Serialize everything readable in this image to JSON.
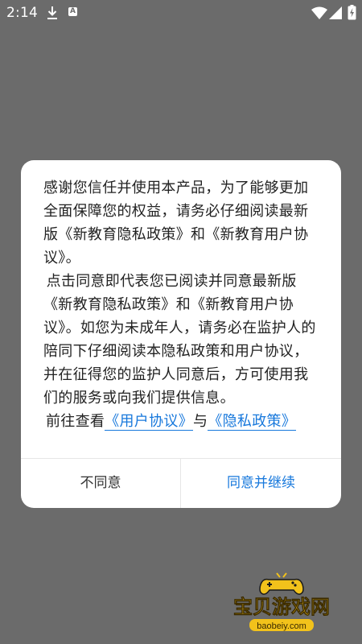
{
  "status_bar": {
    "time": "2:14",
    "notification_badge": "A",
    "icons": [
      "download-icon",
      "a-notification-icon",
      "wifi-icon",
      "signal-icon",
      "battery-icon"
    ]
  },
  "dialog": {
    "paragraph_1": "感谢您信任并使用本产品，为了能够更加全面保障您的权益，请务必仔细阅读最新版《新教育隐私政策》和《新教育用户协议》。",
    "paragraph_2": "点击同意即代表您已阅读并同意最新版《新教育隐私政策》和《新教育用户协议》。如您为未成年人，请务必在监护人的陪同下仔细阅读本隐私政策和用户协议，并在征得您的监护人同意后，方可使用我们的服务或向我们提供信息。",
    "view_prefix": "前往查看",
    "user_agreement_link": "《用户协议》",
    "view_connector": "与",
    "privacy_policy_link": "《隐私政策》",
    "disagree_label": "不同意",
    "agree_label": "同意并继续"
  },
  "watermark": {
    "name": "宝贝游戏网",
    "url": "baobeiy.com"
  },
  "colors": {
    "overlay_background": "#6b6b6b",
    "dialog_background": "#ffffff",
    "body_text": "#222222",
    "link": "#1778dc",
    "divider": "#e6e6e6",
    "watermark_gold": "#f2c21b"
  }
}
